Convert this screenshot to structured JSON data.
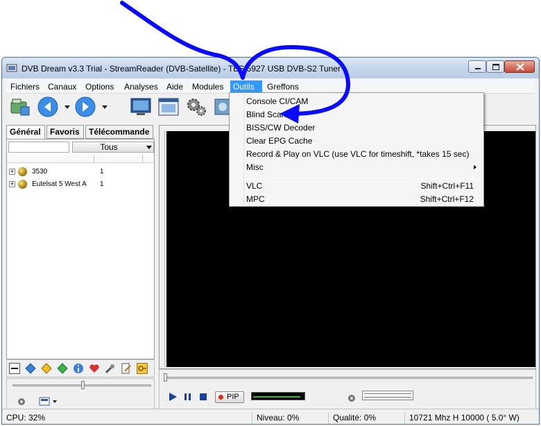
{
  "window": {
    "title": "DVB Dream v3.3 Trial - StreamReader (DVB-Satellite)  - TBS 5927 USB DVB-S2 Tuner"
  },
  "menubar": {
    "items": [
      "Fichiers",
      "Canaux",
      "Options",
      "Analyses",
      "Aide",
      "Modules",
      "Outils",
      "Greffons"
    ],
    "active": "Outils"
  },
  "toolbar": {
    "icons": [
      "open-folder-icon",
      "back-arrow-icon",
      "forward-arrow-icon",
      "monitor-icon",
      "window-icon",
      "gears-icon",
      "capture-icon"
    ]
  },
  "left_panel": {
    "tabs": [
      "Général",
      "Favoris",
      "Télécommande"
    ],
    "active_tab": "Général",
    "search_value": "",
    "filter_value": "Tous",
    "satellites": [
      {
        "name": "3530",
        "count": "1"
      },
      {
        "name": "Eutelsat 5 West A",
        "count": "1"
      }
    ]
  },
  "outils_menu": {
    "items": [
      {
        "label": "Console CI/CAM",
        "shortcut": ""
      },
      {
        "label": "Blind Scanner",
        "shortcut": ""
      },
      {
        "label": "BISS/CW Decoder",
        "shortcut": ""
      },
      {
        "label": "Clear EPG Cache",
        "shortcut": ""
      },
      {
        "label": "Record & Play on VLC (use VLC for timeshift, *takes 15 sec)",
        "shortcut": ""
      },
      {
        "label": "Misc",
        "shortcut": "",
        "submenu": true
      },
      {
        "label": "VLC",
        "shortcut": "Shift+Ctrl+F11"
      },
      {
        "label": "MPC",
        "shortcut": "Shift+Ctrl+F12"
      }
    ]
  },
  "player": {
    "pip_label": "PIP",
    "signal_level": 0.95
  },
  "status": {
    "cpu": "CPU: 32%",
    "niveau": "Niveau: 0%",
    "qualite": "Qualité: 0%",
    "freq": "10721 Mhz  H  10000   ( 5.0° W)"
  },
  "colors": {
    "annotation_arrow": "#0a0aff",
    "menu_highlight": "#3399ff"
  }
}
